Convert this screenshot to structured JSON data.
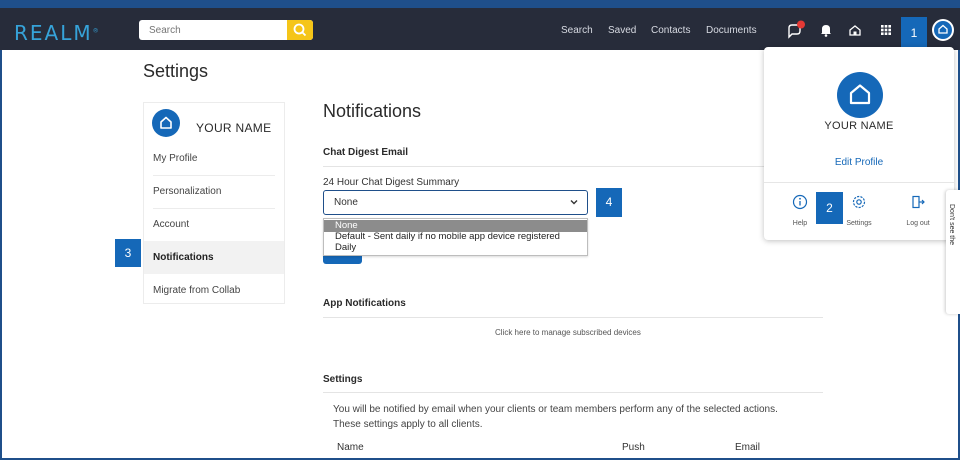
{
  "topbar": {
    "logo": "REALM",
    "search_placeholder": "Search",
    "nav": [
      "Search",
      "Saved",
      "Contacts",
      "Documents"
    ]
  },
  "markers": {
    "m1": "1",
    "m2": "2",
    "m3": "3",
    "m4": "4"
  },
  "page": {
    "settings_title": "Settings"
  },
  "sidebar": {
    "username": "YOUR NAME",
    "items": [
      {
        "label": "My Profile"
      },
      {
        "label": "Personalization"
      },
      {
        "label": "Account"
      },
      {
        "label": "Notifications"
      },
      {
        "label": "Migrate from Collab"
      }
    ]
  },
  "main": {
    "title": "Notifications",
    "chat_digest_section": "Chat Digest Email",
    "digest_label": "24 Hour Chat Digest Summary",
    "select_value": "None",
    "dropdown_options": [
      "None",
      "Default - Sent daily if no mobile app device registered",
      "Daily"
    ],
    "app_notifications_section": "App Notifications",
    "manage_devices_link": "Click here to manage subscribed devices",
    "settings_section": "Settings",
    "settings_desc_1": "You will be notified by email when your clients or team members perform any of the selected actions.",
    "settings_desc_2": "These settings apply to all clients.",
    "columns": {
      "name": "Name",
      "push": "Push",
      "email": "Email"
    }
  },
  "popover": {
    "username": "YOUR NAME",
    "edit_profile": "Edit Profile",
    "actions": {
      "help": "Help",
      "settings": "Settings",
      "logout": "Log out"
    }
  },
  "side_tab": {
    "label": "Don't see the"
  },
  "colors": {
    "brand_blue": "#1568b8",
    "topbar": "#272c3a",
    "search_accent": "#f5c518",
    "notification_red": "#e53935"
  }
}
